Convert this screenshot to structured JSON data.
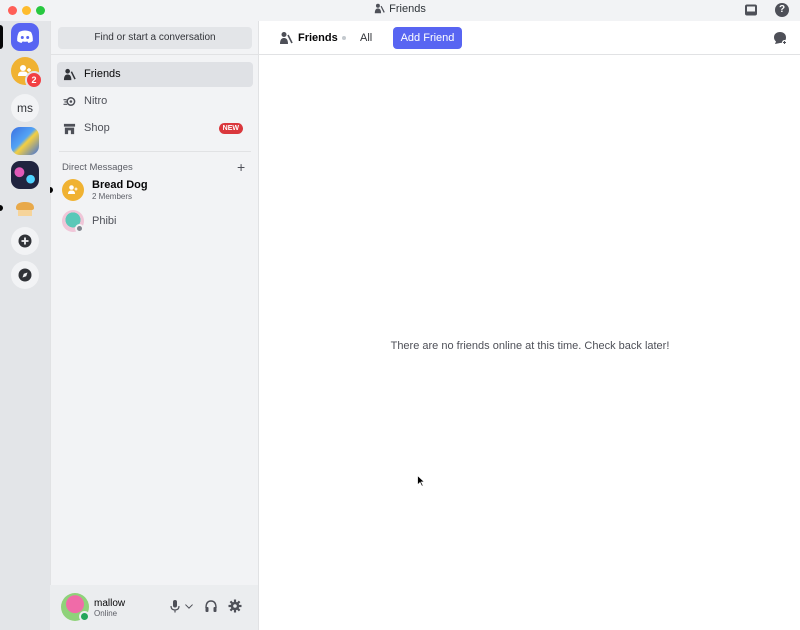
{
  "window": {
    "title": "Friends"
  },
  "rail": {
    "servers": [
      {
        "name": "home",
        "icon": "discord-logo-icon"
      },
      {
        "name": "dm-notification",
        "badge": "2"
      },
      {
        "name": "ms",
        "label": "ms"
      },
      {
        "name": "server-image-1"
      },
      {
        "name": "server-image-2"
      },
      {
        "name": "bread-server",
        "icon": "bread-icon"
      },
      {
        "name": "add-server",
        "icon": "plus-icon"
      },
      {
        "name": "explore",
        "icon": "compass-icon"
      }
    ]
  },
  "sidebar": {
    "search_placeholder": "Find or start a conversation",
    "nav": [
      {
        "label": "Friends",
        "icon": "friends-icon",
        "active": true
      },
      {
        "label": "Nitro",
        "icon": "nitro-icon"
      },
      {
        "label": "Shop",
        "icon": "shop-icon",
        "badge": "NEW"
      }
    ],
    "dm_header": "Direct Messages",
    "dm_add": "+",
    "dms": [
      {
        "name": "Bread Dog",
        "subtitle": "2 Members",
        "unread": true
      },
      {
        "name": "Phibi",
        "subtitle": ""
      }
    ]
  },
  "user_panel": {
    "username": "mallow",
    "status": "Online"
  },
  "main": {
    "topbar": {
      "title": "Friends",
      "tab_all": "All",
      "add_friend": "Add Friend"
    },
    "empty_message": "There are no friends online at this time. Check back later!"
  },
  "colors": {
    "blurple": "#5865f2",
    "online": "#23a55a",
    "danger": "#da373c",
    "yellow": "#f0b232"
  }
}
